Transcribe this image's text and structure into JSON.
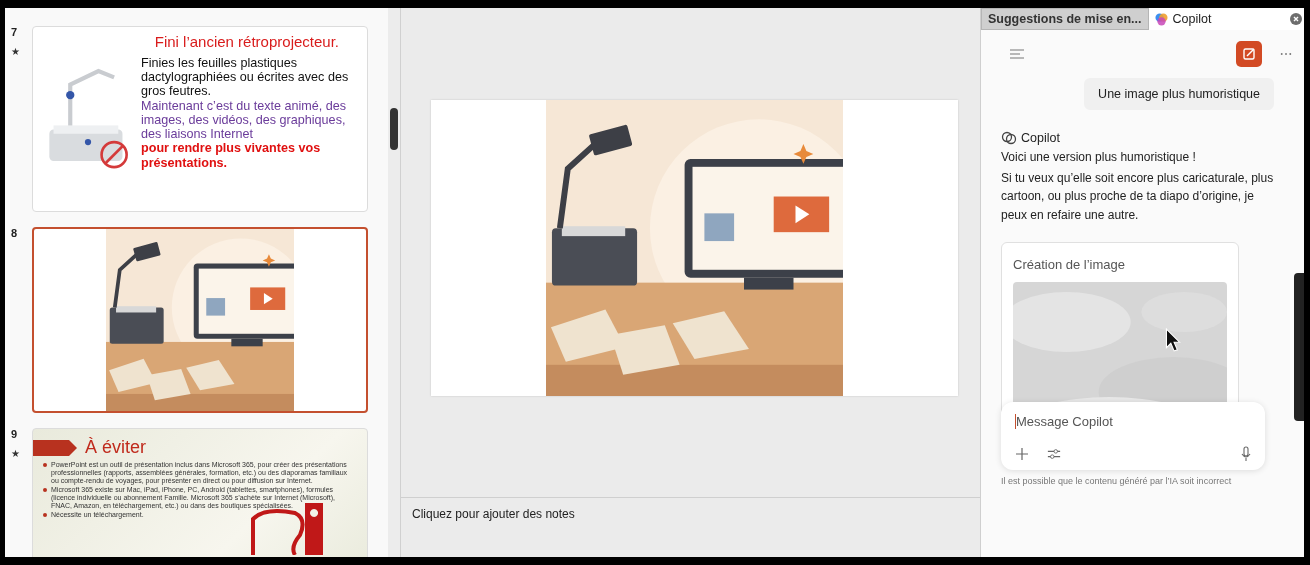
{
  "slides_panel": {
    "slides": [
      {
        "number": "7",
        "marker": "★",
        "selected": false,
        "kind": "text",
        "title": "Fini l’ancien rétroprojecteur.",
        "paragraphs": [
          {
            "kind": "normal",
            "text": "Finies les feuilles plastiques dactylographiées ou écrites avec des gros feutres."
          },
          {
            "kind": "accent",
            "text": "Maintenant c’est du texte animé, des images, des vidéos, des graphiques, des liaisons Internet"
          },
          {
            "kind": "emphasis",
            "text": "pour rendre plus vivantes vos présentations."
          }
        ]
      },
      {
        "number": "8",
        "selected": true
      },
      {
        "number": "9",
        "marker": "★",
        "selected": false,
        "kind": "bullets",
        "title": "À éviter",
        "bullets": [
          "PowerPoint est un outil de présentation inclus dans Microsoft 365, pour créer des présentations professionnelles (rapports, assemblées générales, formation, etc.) ou des diaporamas familiaux ou compte-rendu de voyages, pour présenter en direct ou pour diffusion sur Internet.",
          "Microsoft 365 existe sur Mac, iPad, iPhone, PC, Android (tablettes, smartphones), formules (licence individuelle ou abonnement Famille. Microsoft 365 s’achète sur Internet (Microsoft), FNAC, Amazon, en téléchargement, etc.) ou dans des boutiques spécialisées.",
          "Nécessite un téléchargement."
        ]
      }
    ]
  },
  "editor": {
    "notes": {
      "placeholder": "Cliquez pour ajouter des notes"
    }
  },
  "side_pane": {
    "tabs": [
      {
        "label": "Suggestions de mise en...",
        "selected": false
      },
      {
        "label": "Copilot",
        "selected": true
      }
    ],
    "chat": {
      "user_message": "Une image plus humoristique",
      "assistant_name": "Copilot",
      "assistant_lines": [
        "Voici une version plus humoristique !",
        "Si tu veux qu’elle soit encore plus caricaturale, plus cartoon, ou plus proche de ta diapo d’origine, je peux en refaire une autre."
      ],
      "image_card": {
        "title": "Création de l’image"
      }
    },
    "composer": {
      "placeholder": "Message Copilot"
    },
    "disclaimer": "Il est possible que le contenu généré par l’IA soit incorrect"
  }
}
